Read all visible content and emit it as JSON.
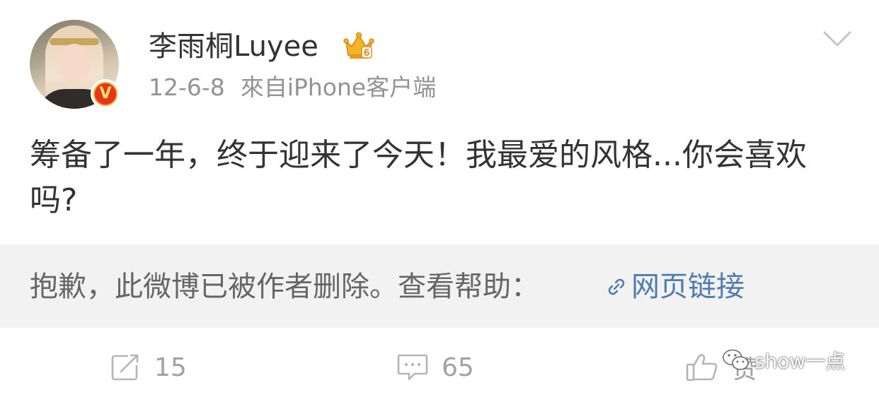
{
  "user": {
    "name": "李雨桐Luyee",
    "verified_badge": "V",
    "crown_level": "6"
  },
  "meta": {
    "time": "12-6-8",
    "source": "來自iPhone客户端"
  },
  "post": {
    "text": "筹备了一年，终于迎来了今天！我最爱的风格...你会喜欢吗?"
  },
  "deleted_notice": {
    "message": "抱歉，此微博已被作者删除。查看帮助：",
    "link_label": "网页链接"
  },
  "actions": {
    "repost_count": "15",
    "comment_count": "65",
    "like_label": "赞"
  },
  "watermark": {
    "text": "show一点"
  },
  "colors": {
    "text_primary": "#333333",
    "text_meta": "#939393",
    "link": "#4f7cae",
    "deleted_bg": "#f2f2f2",
    "verified_orange": "#f6a623",
    "crown_gold": "#f2b52a"
  }
}
